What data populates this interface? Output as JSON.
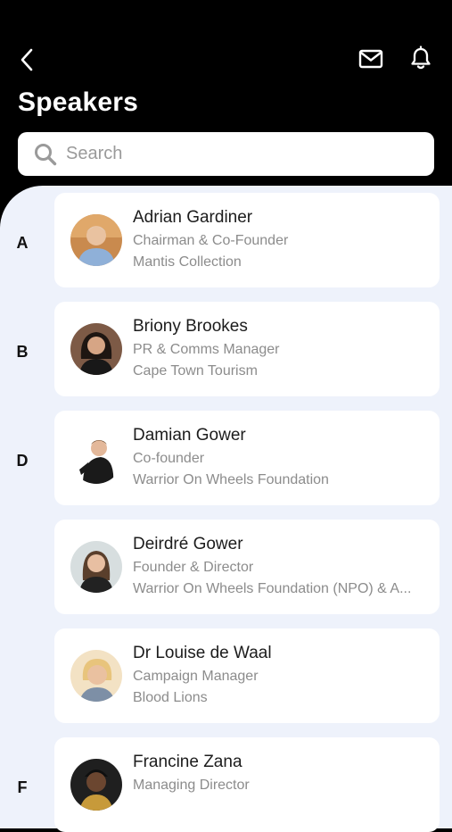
{
  "header": {
    "title": "Speakers",
    "search_placeholder": "Search",
    "icons": [
      "back-arrow-icon",
      "mail-icon",
      "bell-icon"
    ]
  },
  "colors": {
    "header_bg": "#000000",
    "list_bg": "#eef2fb",
    "card_bg": "#ffffff",
    "name_text": "#1c1c1c",
    "secondary_text": "#8c8c8c"
  },
  "letters": [
    "A",
    "B",
    "D",
    "F"
  ],
  "speakers": [
    {
      "name": "Adrian Gardiner",
      "role": "Chairman & Co-Founder",
      "organization": "Mantis Collection"
    },
    {
      "name": "Briony Brookes",
      "role": "PR & Comms Manager",
      "organization": "Cape Town Tourism"
    },
    {
      "name": "Damian Gower",
      "role": "Co-founder",
      "organization": "Warrior On Wheels Foundation"
    },
    {
      "name": "Deirdré Gower",
      "role": "Founder & Director",
      "organization": "Warrior On Wheels Foundation (NPO) & A..."
    },
    {
      "name": "Dr Louise de Waal",
      "role": "Campaign Manager",
      "organization": "Blood Lions"
    },
    {
      "name": "Francine Zana",
      "role": "Managing Director",
      "organization": ""
    }
  ]
}
